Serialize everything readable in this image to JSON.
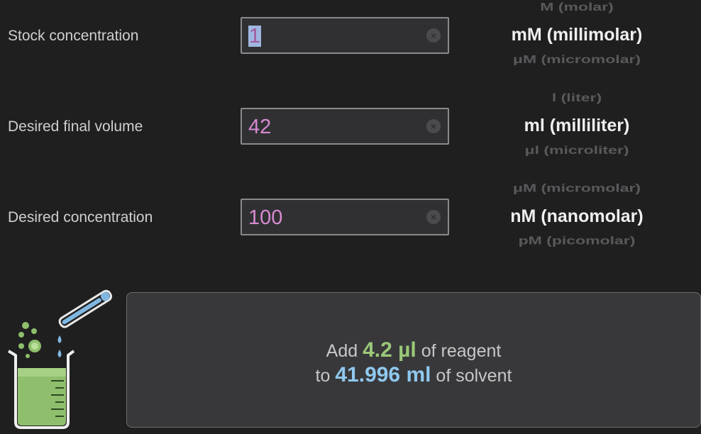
{
  "rows": [
    {
      "label": "Stock concentration",
      "value": "1",
      "unit_prev": "M (molar)",
      "unit_current": "mM (millimolar)",
      "unit_next": "μM (micromolar)"
    },
    {
      "label": "Desired final volume",
      "value": "42",
      "unit_prev": "l (liter)",
      "unit_current": "ml (milliliter)",
      "unit_next": "μl (microliter)"
    },
    {
      "label": "Desired concentration",
      "value": "100",
      "unit_prev": "μM (micromolar)",
      "unit_current": "nM (nanomolar)",
      "unit_next": "pM (picomolar)"
    }
  ],
  "result": {
    "add_prefix": "Add",
    "reagent_amount": "4.2 µl",
    "reagent_suffix": "of reagent",
    "to_prefix": "to",
    "solvent_amount": "41.996 ml",
    "solvent_suffix": "of solvent"
  },
  "icons": {
    "clear": "clear-circle-icon",
    "illustration": "beaker-pipette-icon"
  },
  "colors": {
    "background": "#1f1f20",
    "field_value": "#d68ad0",
    "reagent_highlight": "#9bc878",
    "solvent_highlight": "#8fc8ee"
  }
}
